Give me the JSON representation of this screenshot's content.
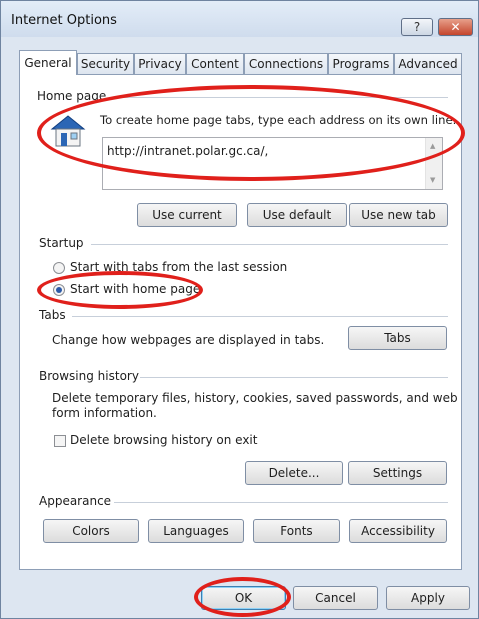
{
  "window": {
    "title": "Internet Options",
    "help_glyph": "?",
    "close_glyph": "✕"
  },
  "tabs": [
    {
      "label": "General"
    },
    {
      "label": "Security"
    },
    {
      "label": "Privacy"
    },
    {
      "label": "Content"
    },
    {
      "label": "Connections"
    },
    {
      "label": "Programs"
    },
    {
      "label": "Advanced"
    }
  ],
  "home_page": {
    "group_label": "Home page",
    "instruction": "To create home page tabs, type each address on its own line.",
    "url_value": "http://intranet.polar.gc.ca/,",
    "use_current": "Use current",
    "use_default": "Use default",
    "use_new_tab": "Use new tab"
  },
  "startup": {
    "group_label": "Startup",
    "option_last_session": "Start with tabs from the last session",
    "option_home_page": "Start with home page",
    "selected": "Start with home page"
  },
  "tabs_section": {
    "group_label": "Tabs",
    "description": "Change how webpages are displayed in tabs.",
    "button": "Tabs"
  },
  "browsing_history": {
    "group_label": "Browsing history",
    "description_line1": "Delete temporary files, history, cookies, saved passwords, and web",
    "description_line2": "form information.",
    "delete_on_exit_label": "Delete browsing history on exit",
    "delete_on_exit_checked": false,
    "delete_button": "Delete...",
    "settings_button": "Settings"
  },
  "appearance": {
    "group_label": "Appearance",
    "colors": "Colors",
    "languages": "Languages",
    "fonts": "Fonts",
    "accessibility": "Accessibility"
  },
  "footer": {
    "ok": "OK",
    "cancel": "Cancel",
    "apply": "Apply"
  },
  "annotation_color": "#e0201b"
}
